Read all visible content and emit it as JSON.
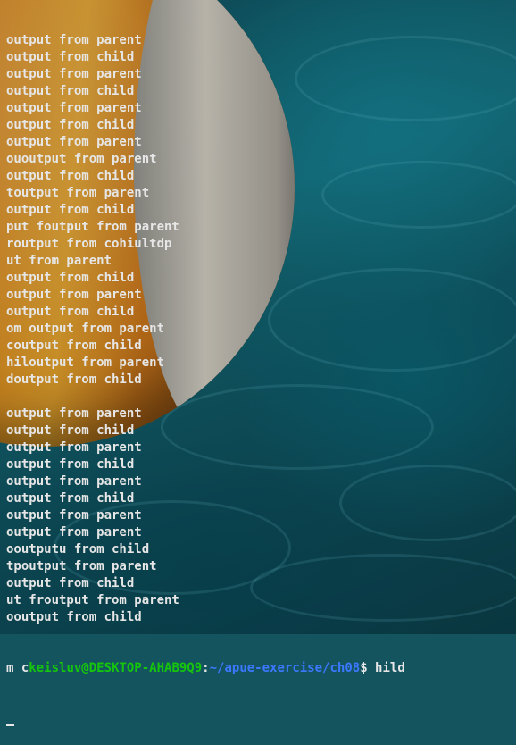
{
  "terminal": {
    "output_lines": [
      "output from parent",
      "output from child",
      "output from parent",
      "output from child",
      "output from parent",
      "output from child",
      "output from parent",
      "ououtput from parent",
      "output from child",
      "toutput from parent",
      "output from child",
      "put foutput from parent",
      "routput from cohiultdp",
      "ut from parent",
      "output from child",
      "output from parent",
      "output from child",
      "om output from parent",
      "coutput from child",
      "hiloutput from parent",
      "doutput from child",
      "",
      "output from parent",
      "output from child",
      "output from parent",
      "output from child",
      "output from parent",
      "output from child",
      "output from parent",
      "output from parent",
      "ooutputu from child",
      "tpoutput from parent",
      "output from child",
      "ut froutput from parent",
      "ooutput from child"
    ],
    "prompt_line": {
      "prefix": "m c",
      "user_host": "keisluv@DESKTOP-AHAB9Q9",
      "separator": ":",
      "path": "~/apue-exercise/ch08",
      "suffix": "$ hild"
    },
    "colors": {
      "text": "#e6e6e6",
      "user_host": "#16c60c",
      "path": "#3b78ff"
    }
  }
}
